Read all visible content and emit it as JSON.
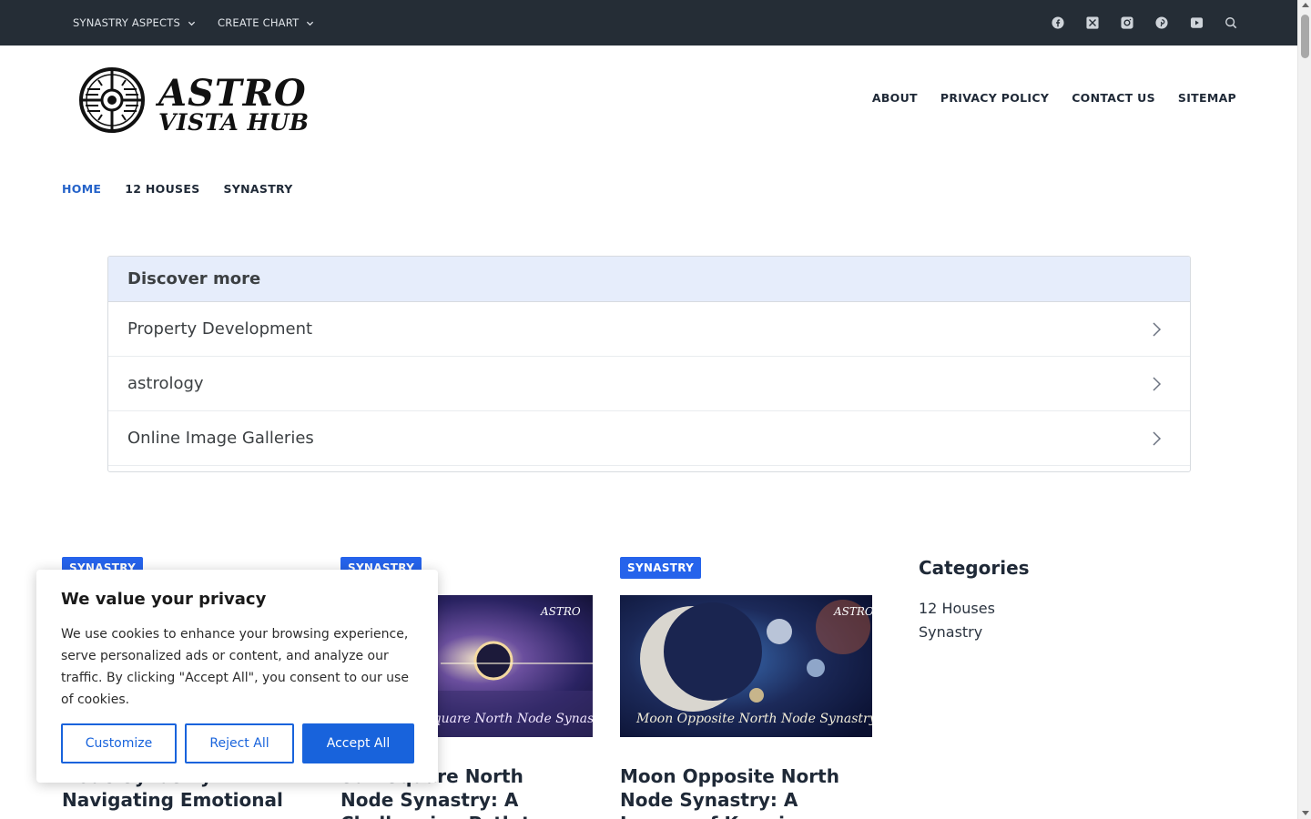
{
  "topbar": {
    "menu": [
      {
        "label": "SYNASTRY ASPECTS"
      },
      {
        "label": "CREATE CHART"
      }
    ],
    "socials": [
      "facebook-icon",
      "x-icon",
      "instagram-icon",
      "pinterest-icon",
      "youtube-icon",
      "search-icon"
    ],
    "bg_color": "#252d36"
  },
  "header": {
    "logo_line1": "ASTRO",
    "logo_line2": "VISTA HUB",
    "nav": [
      "ABOUT",
      "PRIVACY POLICY",
      "CONTACT US",
      "SITEMAP"
    ]
  },
  "subnav": {
    "items": [
      "HOME",
      "12 HOUSES",
      "SYNASTRY"
    ],
    "active_color": "#2563c9"
  },
  "discover": {
    "title": "Discover more",
    "items": [
      "Property Development",
      "astrology",
      "Online Image Galleries"
    ]
  },
  "posts": [
    {
      "category": "SYNASTRY",
      "title_lines": [
        "",
        "Node Synastry:",
        "Navigating Emotional"
      ]
    },
    {
      "category": "SYNASTRY",
      "title_lines": [
        "Sun Square North",
        "Node Synastry: A",
        "Challenging Path to"
      ],
      "image_text": "Sun Square North Node Synastry"
    },
    {
      "category": "SYNASTRY",
      "title_lines": [
        "Moon Opposite North",
        "Node Synastry: A",
        "Lesson of Karmic"
      ],
      "image_text": "Moon Opposite North Node Synastry"
    }
  ],
  "sidebar": {
    "heading": "Categories",
    "links": [
      "12 Houses",
      "Synastry"
    ]
  },
  "cookie": {
    "title": "We value your privacy",
    "body": "We use cookies to enhance your browsing experience, serve personalized ads or content, and analyze our traffic. By clicking \"Accept All\", you consent to our use of cookies.",
    "customize": "Customize",
    "reject": "Reject All",
    "accept": "Accept All",
    "accent_color": "#1863dc"
  },
  "colors": {
    "badge": "#2563eb",
    "discover_header": "#e6edfb"
  }
}
